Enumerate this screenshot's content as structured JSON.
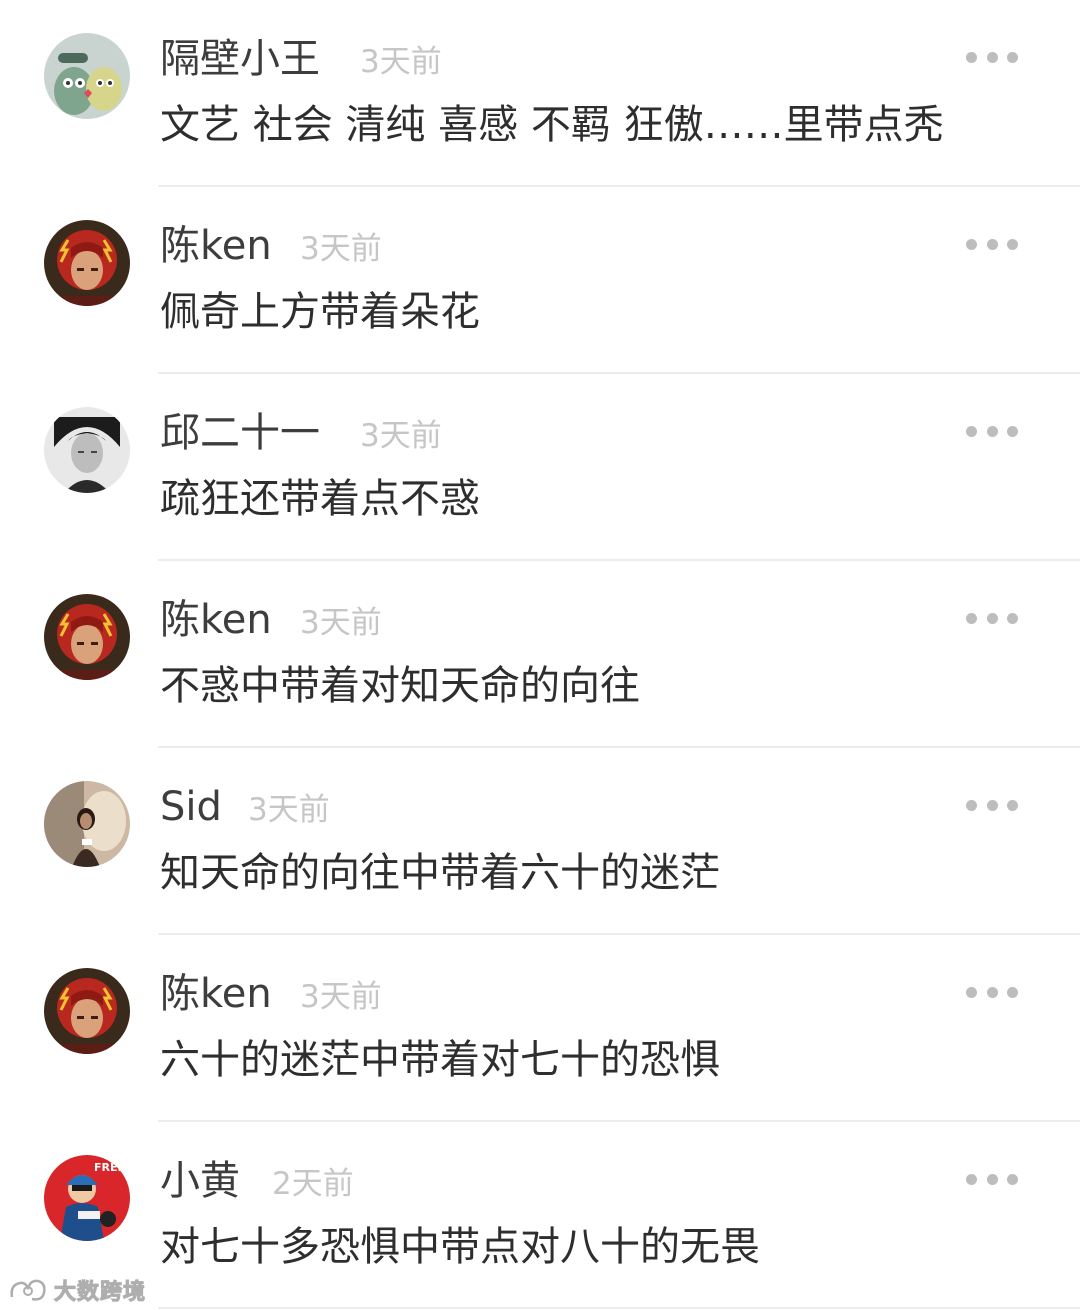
{
  "comments": [
    {
      "user": "隔壁小王",
      "time": "3天前",
      "text": "文艺 社会 清纯 喜感 不羁 狂傲……里带点秃",
      "avatar": "cartoon-couple-avatar"
    },
    {
      "user": "陈ken",
      "time": "3天前",
      "text": "佩奇上方带着朵花",
      "avatar": "flash-hero-avatar"
    },
    {
      "user": "邱二十一",
      "time": "3天前",
      "text": "疏狂还带着点不惑",
      "avatar": "bw-portrait-avatar"
    },
    {
      "user": "陈ken",
      "time": "3天前",
      "text": "不惑中带着对知天命的向往",
      "avatar": "flash-hero-avatar"
    },
    {
      "user": "Sid",
      "time": "3天前",
      "text": "知天命的向往中带着六十的迷茫",
      "avatar": "sunlit-portrait-avatar"
    },
    {
      "user": "陈ken",
      "time": "3天前",
      "text": "六十的迷茫中带着对七十的恐惧",
      "avatar": "flash-hero-avatar"
    },
    {
      "user": "小黄",
      "time": "2天前",
      "text": "对七十多恐惧中带点对八十的无畏",
      "avatar": "freestyle-cartoon-avatar"
    }
  ],
  "watermark": {
    "text": "大数跨境"
  },
  "colors": {
    "name": "#3d3d3d",
    "time": "#c6c6c6",
    "text": "#2e2e2e",
    "divider": "#ededed",
    "more": "#bdbdbd"
  }
}
